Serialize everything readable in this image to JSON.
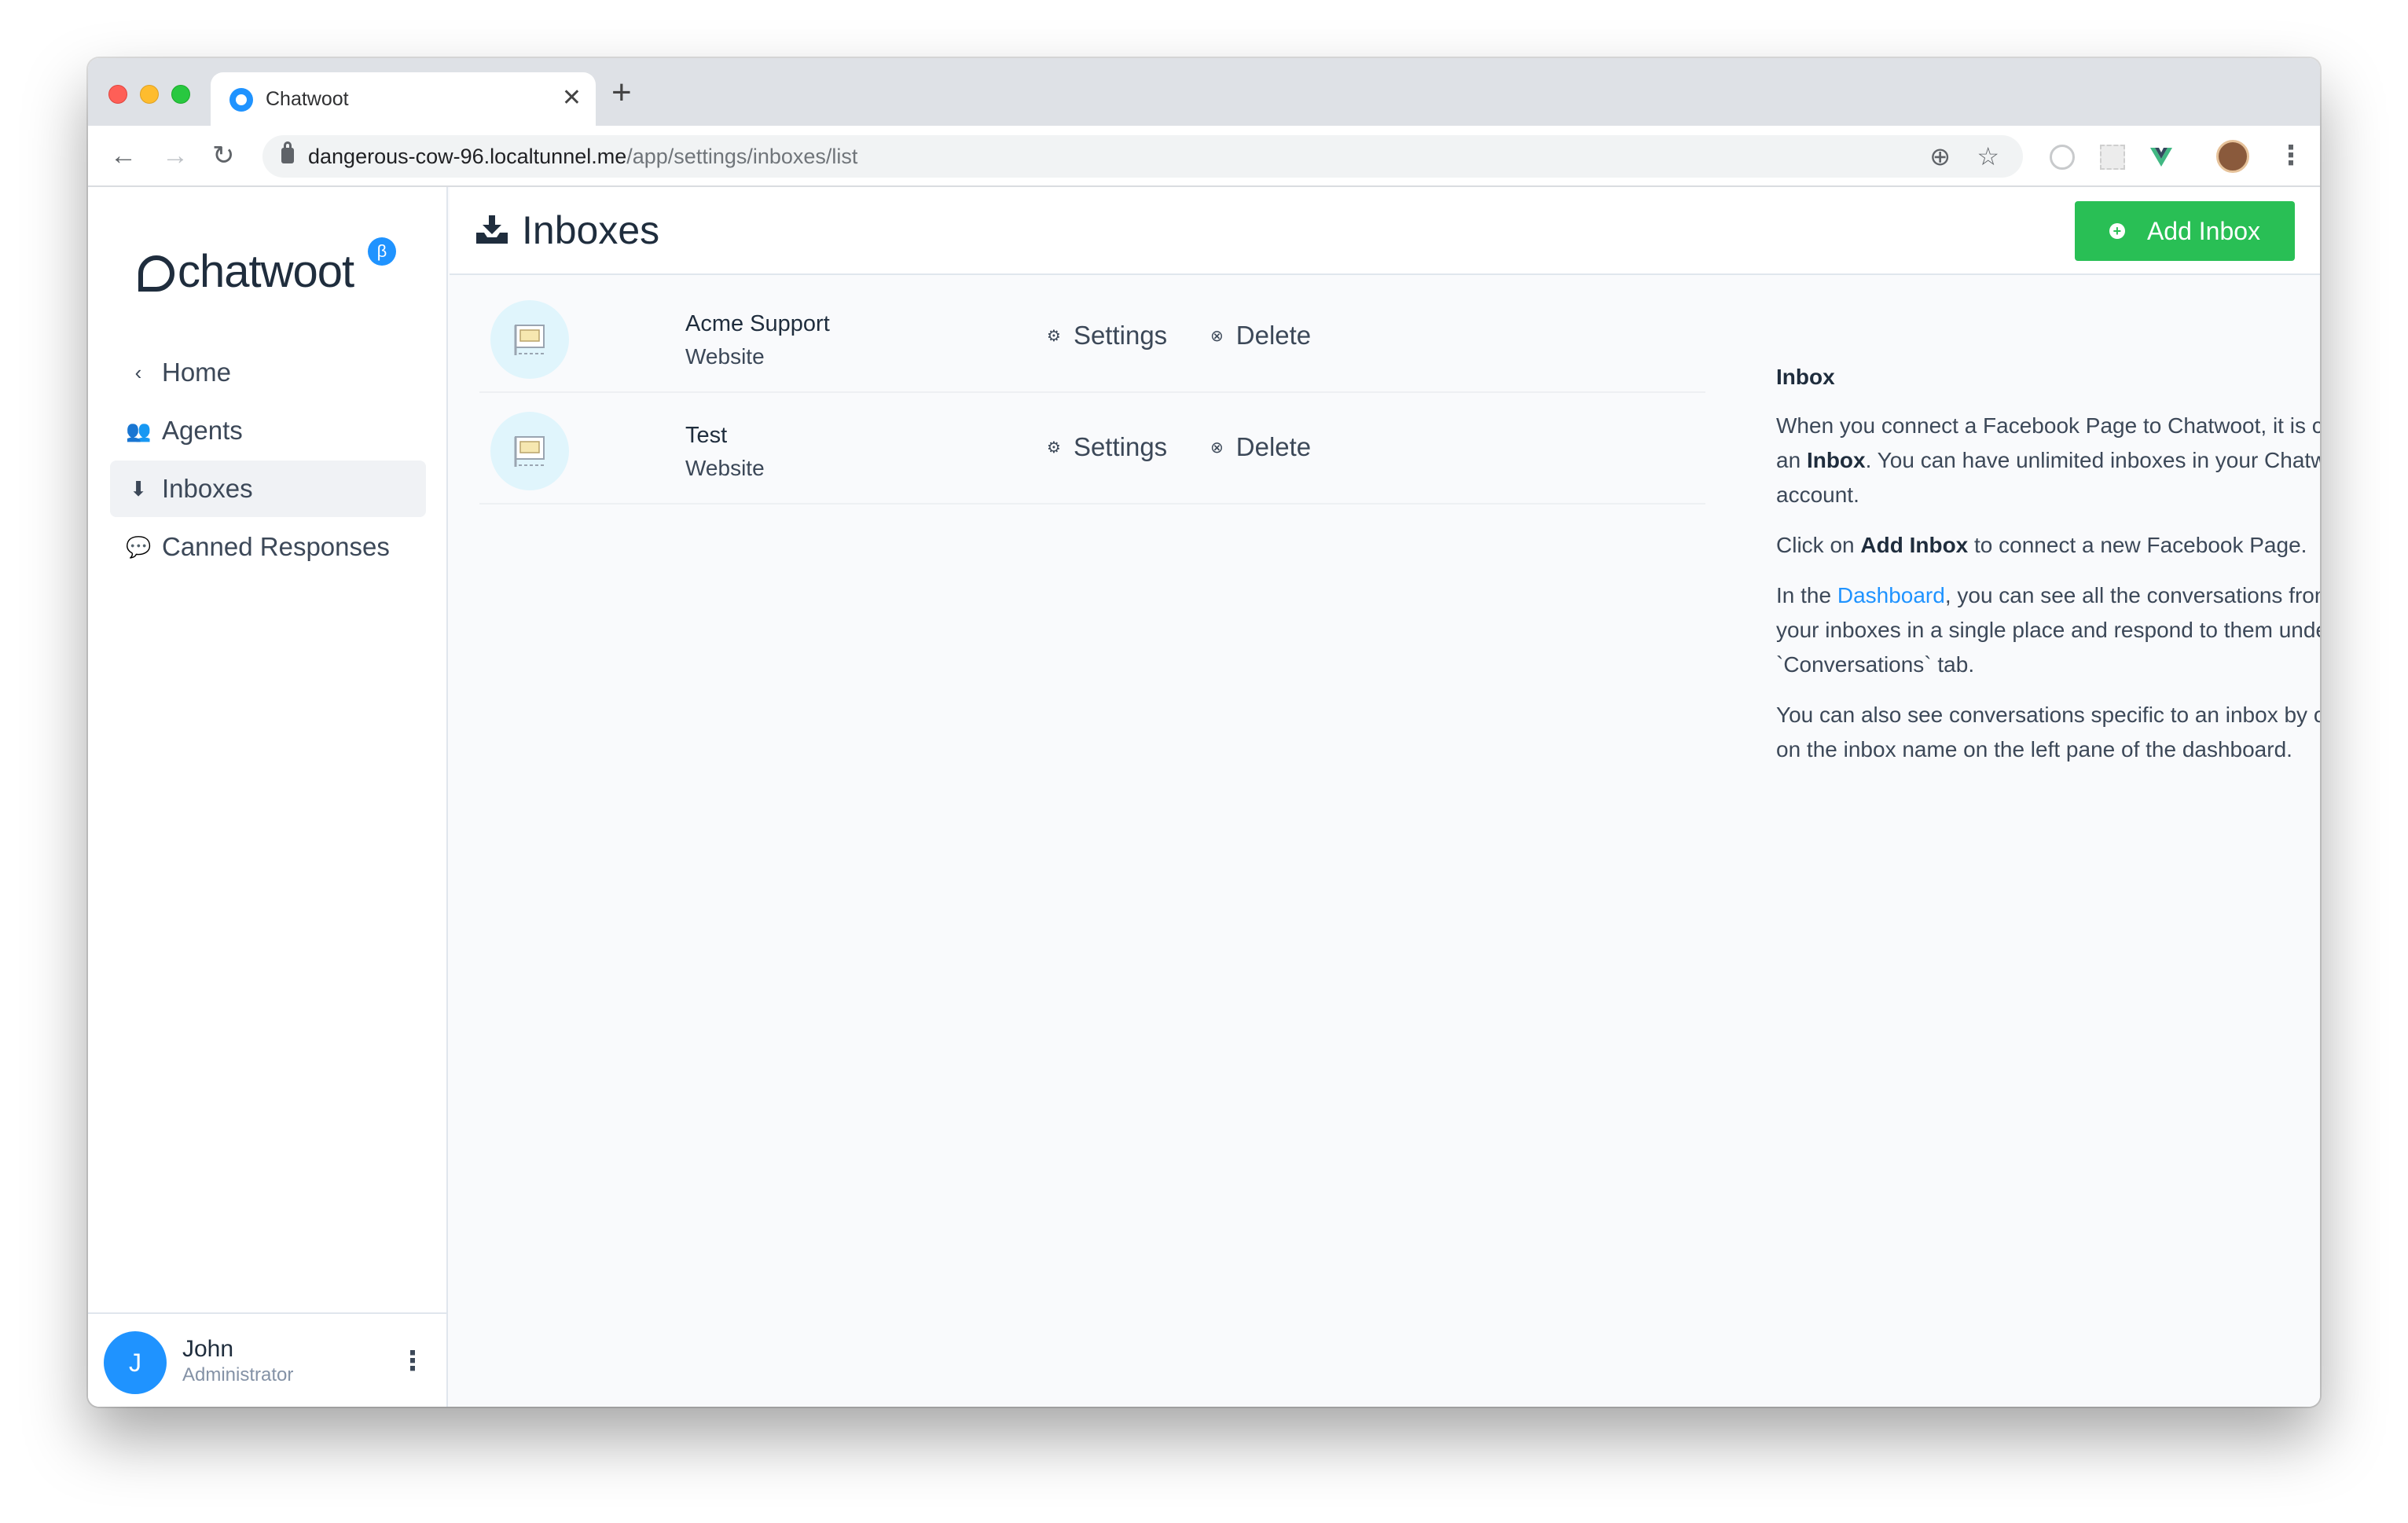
{
  "browser": {
    "tab_title": "Chatwoot",
    "tab_close": "✕",
    "new_tab": "+",
    "url_host": "dangerous-cow-96.localtunnel.me",
    "url_path": "/app/settings/inboxes/list",
    "nav": {
      "back": "←",
      "forward": "→",
      "reload": "↻"
    },
    "omni_icons": {
      "add": "⊕",
      "bookmark": "☆"
    },
    "extensions": [
      "timer-extension-icon",
      "qr-extension-icon",
      "vue-devtools-icon",
      "profile-avatar-icon"
    ],
    "menu": "⋮"
  },
  "sidebar": {
    "logo_text": "chatwoot",
    "beta_badge": "β",
    "items": [
      {
        "label": "Home",
        "icon": "‹"
      },
      {
        "label": "Agents",
        "icon": "👥"
      },
      {
        "label": "Inboxes",
        "icon": "⬇"
      },
      {
        "label": "Canned Responses",
        "icon": "💬"
      }
    ],
    "profile": {
      "initial": "J",
      "name": "John",
      "role": "Administrator",
      "menu": "⋮"
    }
  },
  "header": {
    "title": "Inboxes",
    "add_button": "Add Inbox",
    "add_icon": "+"
  },
  "inboxes": [
    {
      "name": "Acme Support",
      "type": "Website",
      "settings": "Settings",
      "delete": "Delete"
    },
    {
      "name": "Test",
      "type": "Website",
      "settings": "Settings",
      "delete": "Delete"
    }
  ],
  "help": {
    "heading": "Inbox",
    "p1_a": "When you connect a Facebook Page to Chatwoot, it is called an ",
    "p1_bold": "Inbox",
    "p1_b": ". You can have unlimited inboxes in your Chatwoot account.",
    "p2_a": "Click on ",
    "p2_bold": "Add Inbox",
    "p2_b": " to connect a new Facebook Page.",
    "p3_a": "In the ",
    "p3_link": "Dashboard",
    "p3_b": ", you can see all the conversations from all your inboxes in a single place and respond to them under the `Conversations` tab.",
    "p4": "You can also see conversations specific to an inbox by clicking on the inbox name on the left pane of the dashboard."
  },
  "colors": {
    "accent": "#1f93ff",
    "button_green": "#29bf55",
    "text": "#1f2d3d"
  }
}
